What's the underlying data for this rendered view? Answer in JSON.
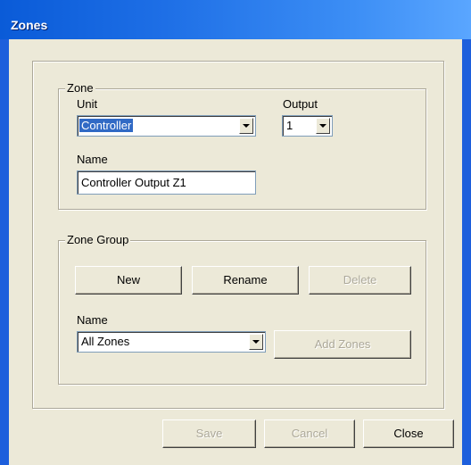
{
  "window": {
    "title": "Zones"
  },
  "zone": {
    "legend": "Zone",
    "unit_label": "Unit",
    "unit_value": "Controller",
    "output_label": "Output",
    "output_value": "1",
    "name_label": "Name",
    "name_value": "Controller Output Z1"
  },
  "zone_group": {
    "legend": "Zone Group",
    "new_label": "New",
    "rename_label": "Rename",
    "delete_label": "Delete",
    "name_label": "Name",
    "name_value": "All Zones",
    "add_zones_label": "Add Zones"
  },
  "footer": {
    "save_label": "Save",
    "cancel_label": "Cancel",
    "close_label": "Close"
  },
  "icons": {
    "dropdown": "chevron-down-icon"
  }
}
